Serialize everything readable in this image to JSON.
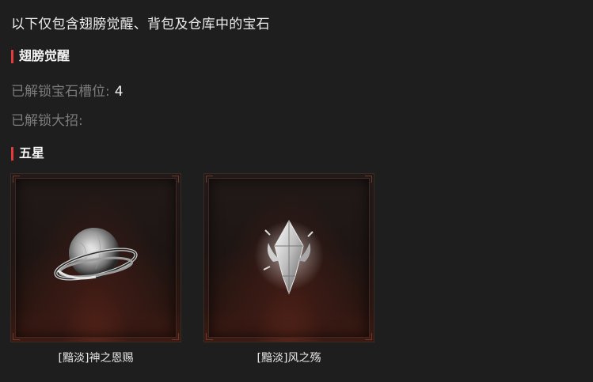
{
  "intro_text": "以下仅包含翅膀觉醒、背包及仓库中的宝石",
  "wing_section": {
    "title": "翅膀觉醒",
    "unlocked_slots_label": "已解锁宝石槽位:",
    "unlocked_slots_value": "4",
    "unlocked_ultimate_label": "已解锁大招:"
  },
  "five_star_section": {
    "title": "五星",
    "gems": [
      {
        "name": "[黯淡]神之恩赐",
        "icon": "silver-orb-icon"
      },
      {
        "name": "[黯淡]风之殇",
        "icon": "silver-crystal-icon"
      }
    ]
  },
  "colors": {
    "accent_bar": "#e23b3b",
    "background": "#1e1e1e",
    "muted_text": "#7b7b7b"
  }
}
